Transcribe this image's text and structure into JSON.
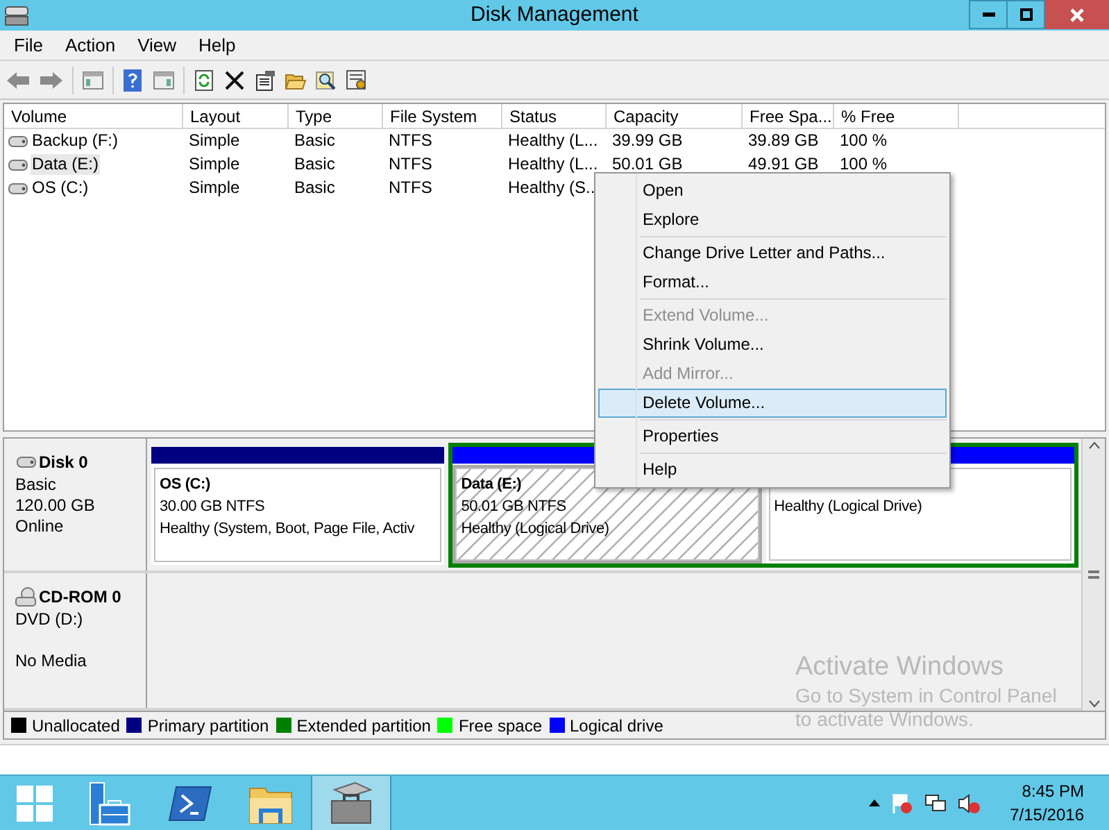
{
  "window": {
    "title": "Disk Management"
  },
  "menu": [
    "File",
    "Action",
    "View",
    "Help"
  ],
  "table": {
    "columns": [
      "Volume",
      "Layout",
      "Type",
      "File System",
      "Status",
      "Capacity",
      "Free Spa...",
      "% Free"
    ],
    "rows": [
      {
        "selected": false,
        "cells": [
          "Backup (F:)",
          "Simple",
          "Basic",
          "NTFS",
          "Healthy (L...",
          "39.99 GB",
          "39.89 GB",
          "100 %"
        ]
      },
      {
        "selected": true,
        "cells": [
          "Data (E:)",
          "Simple",
          "Basic",
          "NTFS",
          "Healthy (L...",
          "50.01 GB",
          "49.91 GB",
          "100 %"
        ]
      },
      {
        "selected": false,
        "cells": [
          "OS (C:)",
          "Simple",
          "Basic",
          "NTFS",
          "Healthy (S.."
        ]
      }
    ]
  },
  "disks": [
    {
      "kind": "disk",
      "name": "Disk 0",
      "lines": [
        "Basic",
        "120.00 GB",
        "Online"
      ],
      "partitions": [
        {
          "kind": "primary",
          "title": "OS  (C:)",
          "size": "30.00 GB NTFS",
          "status": "Healthy (System, Boot, Page File, Activ",
          "selected": false
        },
        {
          "kind": "extended",
          "children": [
            {
              "kind": "logical",
              "title": "Data  (E:)",
              "size": "50.01 GB NTFS",
              "status": "Healthy (Logical Drive)",
              "selected": true
            },
            {
              "kind": "logical",
              "status": "Healthy (Logical Drive)",
              "selected": false
            }
          ]
        }
      ]
    },
    {
      "kind": "cdrom",
      "name": "CD-ROM 0",
      "lines": [
        "DVD (D:)",
        "No Media"
      ]
    }
  ],
  "legend": [
    {
      "label": "Unallocated",
      "color": "#000000"
    },
    {
      "label": "Primary partition",
      "color": "#000080"
    },
    {
      "label": "Extended partition",
      "color": "#008000"
    },
    {
      "label": "Free space",
      "color": "#00ff00"
    },
    {
      "label": "Logical drive",
      "color": "#0000ff"
    }
  ],
  "activation_notice": {
    "title": "Activate Windows",
    "lines": [
      "Go to System in Control Panel",
      "to activate Windows."
    ]
  },
  "context_menu": [
    {
      "kind": "item",
      "label": "Open",
      "disabled": false,
      "selected": false
    },
    {
      "kind": "item",
      "label": "Explore",
      "disabled": false,
      "selected": false
    },
    {
      "kind": "separator"
    },
    {
      "kind": "item",
      "label": "Change Drive Letter and Paths...",
      "disabled": false,
      "selected": false
    },
    {
      "kind": "item",
      "label": "Format...",
      "disabled": false,
      "selected": false
    },
    {
      "kind": "separator"
    },
    {
      "kind": "item",
      "label": "Extend Volume...",
      "disabled": true,
      "selected": false
    },
    {
      "kind": "item",
      "label": "Shrink Volume...",
      "disabled": false,
      "selected": false
    },
    {
      "kind": "item",
      "label": "Add Mirror...",
      "disabled": true,
      "selected": false
    },
    {
      "kind": "item",
      "label": "Delete Volume...",
      "disabled": false,
      "selected": true
    },
    {
      "kind": "separator"
    },
    {
      "kind": "item",
      "label": "Properties",
      "disabled": false,
      "selected": false
    },
    {
      "kind": "separator"
    },
    {
      "kind": "item",
      "label": "Help",
      "disabled": false,
      "selected": false
    }
  ],
  "taskbar": {
    "apps": [
      {
        "kind": "server",
        "selected": false
      },
      {
        "kind": "powershell",
        "selected": false
      },
      {
        "kind": "explorer",
        "selected": false
      },
      {
        "kind": "disk",
        "selected": true
      }
    ],
    "time": "8:45 PM",
    "date": "7/15/2016"
  }
}
